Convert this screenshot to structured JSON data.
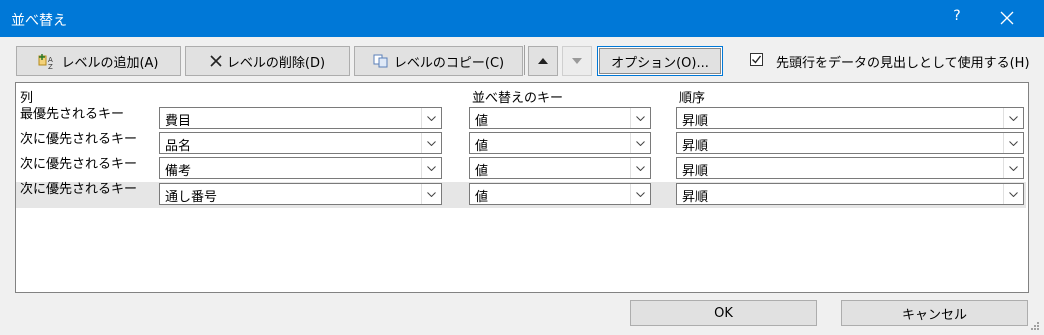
{
  "window": {
    "title": "並べ替え",
    "help": "?"
  },
  "toolbar": {
    "add_level": "レベルの追加(A)",
    "delete_level": "レベルの削除(D)",
    "copy_level": "レベルのコピー(C)",
    "options": "オプション(O)...",
    "header_checkbox_label": "先頭行をデータの見出しとして使用する(H)",
    "header_checkbox_checked": true
  },
  "table": {
    "headers": {
      "column": "列",
      "sort_on": "並べ替えのキー",
      "order": "順序"
    },
    "rows": [
      {
        "label": "最優先されるキー",
        "column": "費目",
        "sort_on": "値",
        "order": "昇順"
      },
      {
        "label": "次に優先されるキー",
        "column": "品名",
        "sort_on": "値",
        "order": "昇順"
      },
      {
        "label": "次に優先されるキー",
        "column": "備考",
        "sort_on": "値",
        "order": "昇順"
      },
      {
        "label": "次に優先されるキー",
        "column": "通し番号",
        "sort_on": "値",
        "order": "昇順"
      }
    ]
  },
  "footer": {
    "ok": "OK",
    "cancel": "キャンセル"
  }
}
